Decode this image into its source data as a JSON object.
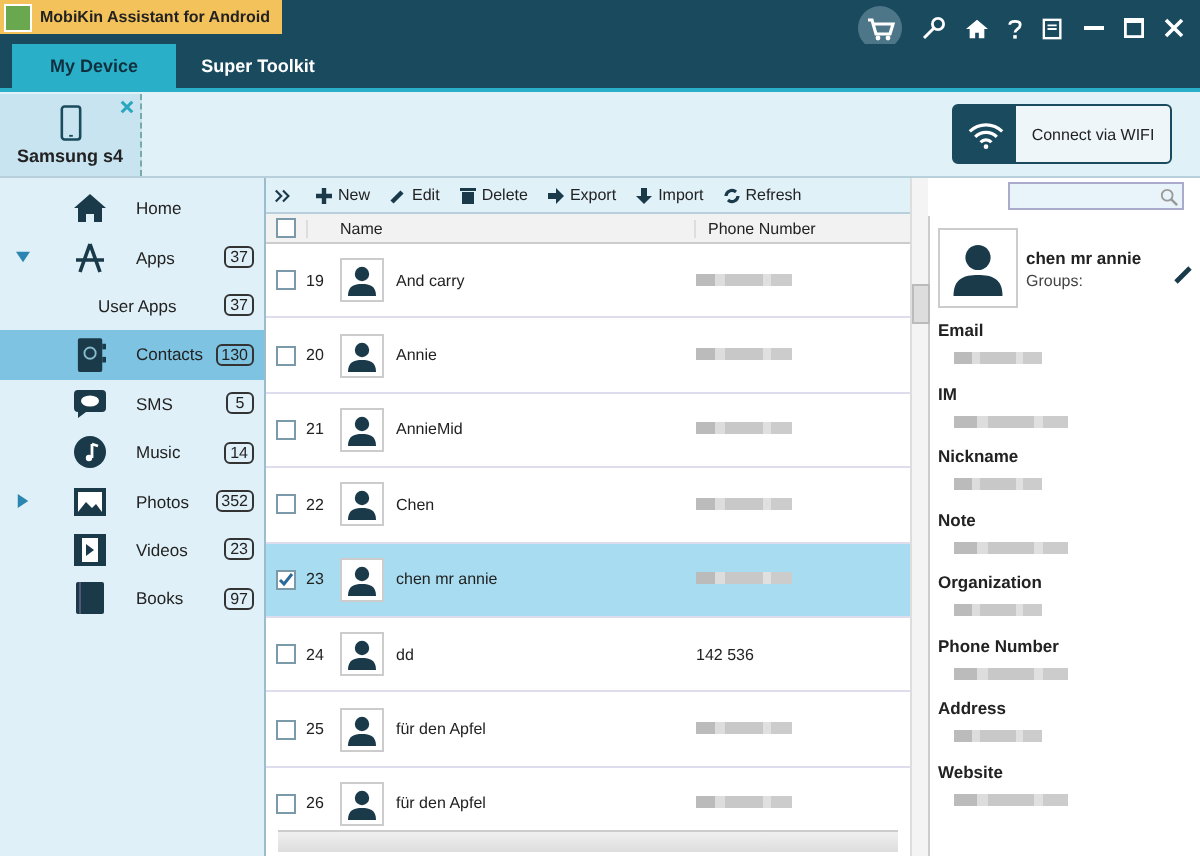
{
  "window": {
    "title": "MobiKin Assistant for Android"
  },
  "tabs": [
    {
      "label": "My Device",
      "selected": true
    },
    {
      "label": "Super Toolkit",
      "selected": false
    }
  ],
  "device": {
    "name": "Samsung s4"
  },
  "wifi_button": {
    "label": "Connect via WIFI"
  },
  "sidebar": {
    "items": [
      {
        "kind": "home",
        "label": "Home",
        "selected": false
      },
      {
        "kind": "apps",
        "label": "Apps",
        "count": "37",
        "expanded": true,
        "selected": false,
        "children": [
          {
            "label": "User Apps",
            "count": "37",
            "selected": false
          }
        ]
      },
      {
        "kind": "contacts",
        "label": "Contacts",
        "count": "130",
        "selected": true
      },
      {
        "kind": "sms",
        "label": "SMS",
        "count": "5",
        "selected": false
      },
      {
        "kind": "music",
        "label": "Music",
        "count": "14",
        "selected": false
      },
      {
        "kind": "photos",
        "label": "Photos",
        "count": "352",
        "expanded": false,
        "selected": false
      },
      {
        "kind": "videos",
        "label": "Videos",
        "count": "23",
        "selected": false
      },
      {
        "kind": "books",
        "label": "Books",
        "count": "97",
        "selected": false
      }
    ]
  },
  "toolbar": [
    {
      "kind": "new",
      "label": "New"
    },
    {
      "kind": "edit",
      "label": "Edit"
    },
    {
      "kind": "delete",
      "label": "Delete"
    },
    {
      "kind": "export",
      "label": "Export"
    },
    {
      "kind": "import",
      "label": "Import"
    },
    {
      "kind": "refresh",
      "label": "Refresh"
    }
  ],
  "table": {
    "all_checked": false,
    "columns": [
      "Name",
      "Phone Number"
    ],
    "rows": [
      {
        "index": "19",
        "name": "And  carry",
        "phone_redacted": true,
        "selected": false
      },
      {
        "index": "20",
        "name": "Annie",
        "phone_redacted": true,
        "selected": false
      },
      {
        "index": "21",
        "name": "AnnieMid",
        "phone_redacted": true,
        "selected": false
      },
      {
        "index": "22",
        "name": "Chen",
        "phone_redacted": true,
        "selected": false
      },
      {
        "index": "23",
        "name": "chen mr annie",
        "phone_redacted": true,
        "selected": true
      },
      {
        "index": "24",
        "name": "dd",
        "phone": "142 536",
        "selected": false
      },
      {
        "index": "25",
        "name": "für den Apfel",
        "phone_redacted": true,
        "selected": false
      },
      {
        "index": "26",
        "name": "für den Apfel",
        "phone_redacted": true,
        "selected": false
      }
    ]
  },
  "details": {
    "name": "chen mr annie",
    "groups_label": "Groups:",
    "fields": [
      {
        "label": "Email",
        "redacted": true
      },
      {
        "label": "IM",
        "redacted": true
      },
      {
        "label": "Nickname",
        "redacted": true
      },
      {
        "label": "Note",
        "redacted": true
      },
      {
        "label": "Organization",
        "redacted": true
      },
      {
        "label": "Phone Number",
        "redacted": true
      },
      {
        "label": "Address",
        "redacted": true
      },
      {
        "label": "Website",
        "redacted": true
      }
    ]
  }
}
